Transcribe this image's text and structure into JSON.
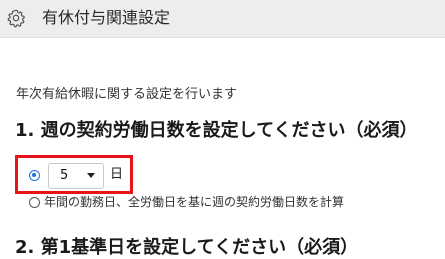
{
  "header": {
    "icon": "gear-icon",
    "title": "有休付与関連設定"
  },
  "intro_text": "年次有給休暇に関する設定を行います",
  "section1": {
    "heading": "1. 週の契約労働日数を設定してください（必須）",
    "option_fixed": {
      "selected": true,
      "select_value": "5",
      "unit": "日"
    },
    "option_calculate": {
      "selected": false,
      "label": "年間の勤務日、全労働日を基に週の契約労働日数を計算"
    }
  },
  "section2": {
    "heading": "2. 第1基準日を設定してください（必須）"
  },
  "colors": {
    "highlight": "#e8141a",
    "radio_selected": "#1a73e8",
    "header_bg": "#ededed"
  }
}
